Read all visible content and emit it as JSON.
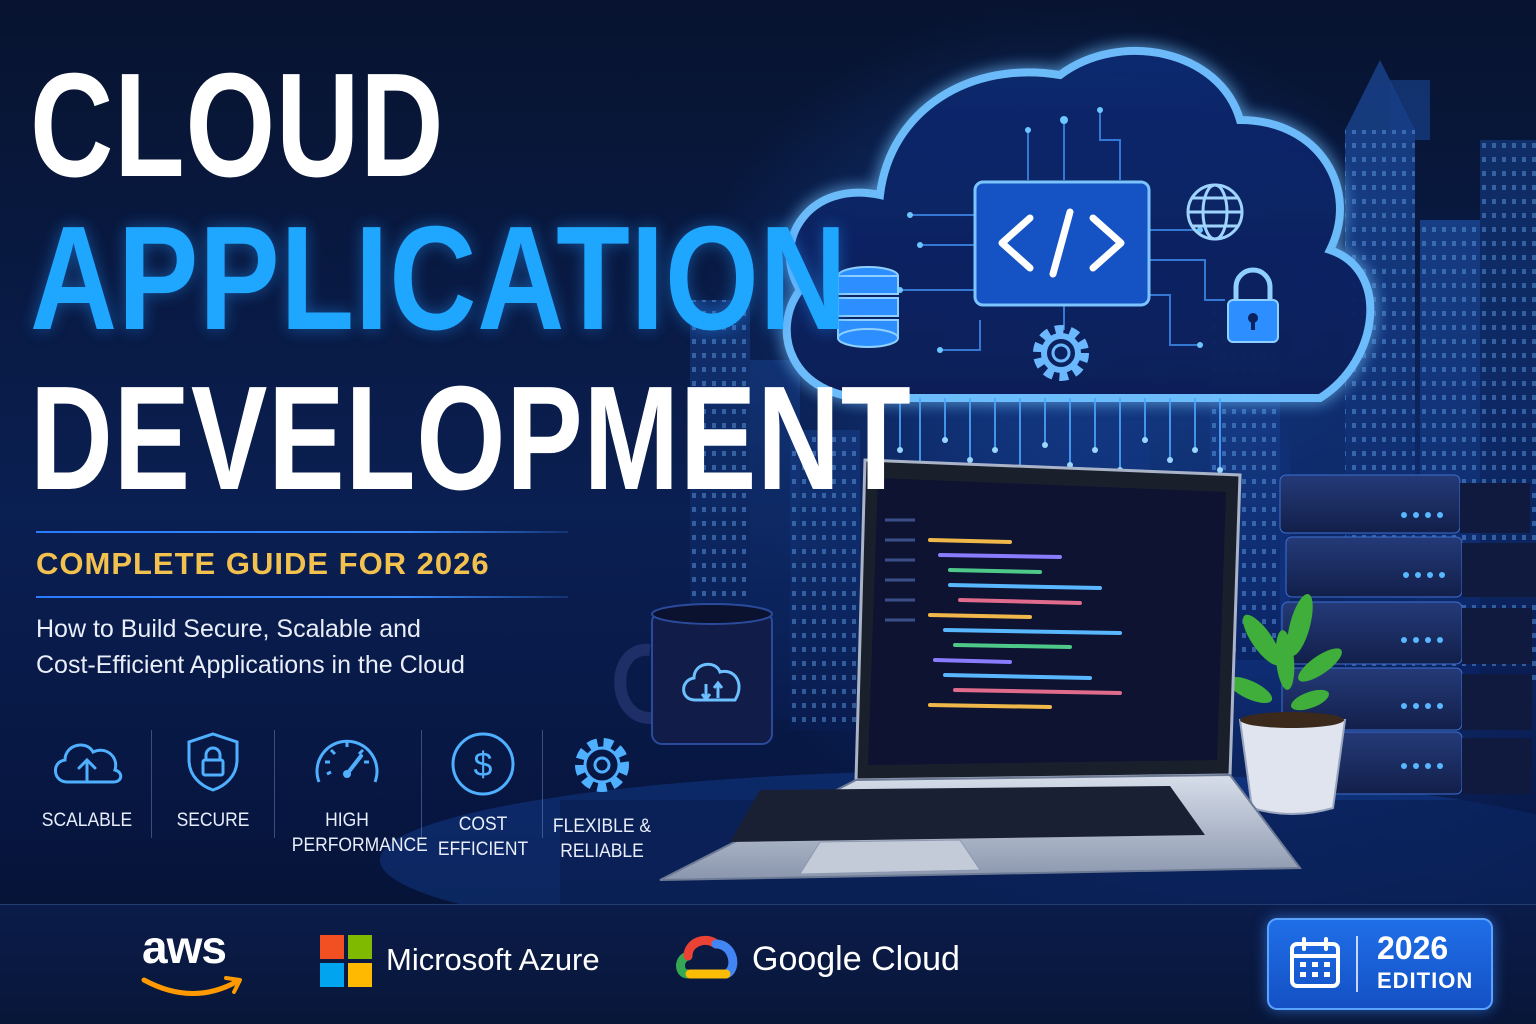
{
  "title": {
    "line1": "CLOUD",
    "line2": "APPLICATION",
    "line3": "DEVELOPMENT"
  },
  "guide_label": "COMPLETE GUIDE FOR 2026",
  "subtitle": {
    "line1": "How to Build Secure, Scalable and",
    "line2": "Cost-Efficient Applications in the Cloud"
  },
  "features": [
    {
      "label": "SCALABLE",
      "icon": "cloud-upload-icon"
    },
    {
      "label": "SECURE",
      "icon": "shield-lock-icon"
    },
    {
      "label": "HIGH\nPERFORMANCE",
      "icon": "speedometer-icon"
    },
    {
      "label": "COST\nEFFICIENT",
      "icon": "dollar-coin-icon"
    },
    {
      "label": "FLEXIBLE &\nRELIABLE",
      "icon": "gear-icon"
    }
  ],
  "providers": {
    "aws": "aws",
    "azure": "Microsoft Azure",
    "google": "Google Cloud"
  },
  "edition": {
    "year": "2026",
    "word": "EDITION",
    "icon": "calendar-icon"
  },
  "illustration": {
    "cloud_icons": [
      "code-brackets-icon",
      "database-icon",
      "globe-icon",
      "lock-icon",
      "gear-icon"
    ],
    "mug_icon": "cloud-sync-icon"
  },
  "colors": {
    "accent_blue": "#1fa6ff",
    "guide_gold": "#f2c14e",
    "background": "#06102e",
    "edition_blue": "#1f6fe8"
  }
}
